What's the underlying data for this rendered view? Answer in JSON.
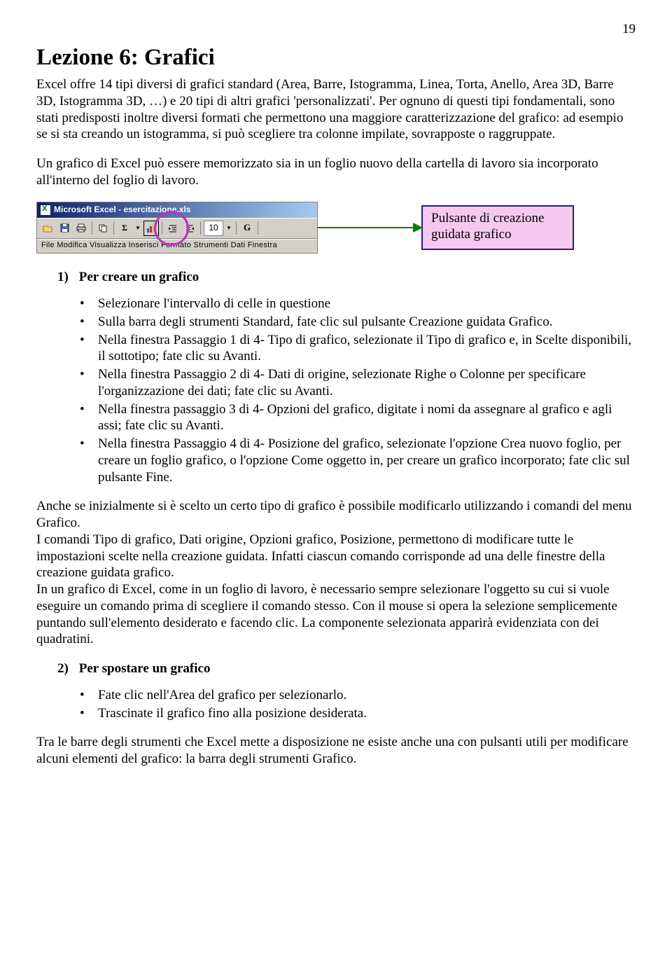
{
  "page_number": "19",
  "title": "Lezione 6: Grafici",
  "intro_p1": "Excel offre 14 tipi diversi di grafici standard (Area, Barre, Istogramma, Linea, Torta, Anello, Area 3D, Barre 3D, Istogramma 3D, …) e 20 tipi di altri grafici 'personalizzati'. Per ognuno di questi tipi fondamentali, sono stati predisposti inoltre diversi formati che permettono una maggiore caratterizzazione del grafico: ad esempio se si sta creando un istogramma, si può scegliere tra colonne impilate, sovrapposte o raggruppate.",
  "intro_p2": "Un grafico di Excel può essere memorizzato sia in un foglio nuovo della cartella di lavoro sia incorporato all'interno del foglio di lavoro.",
  "toolbar": {
    "title": "Microsoft Excel - esercitazione.xls",
    "menu": "File  Modifica  Visualizza  Inserisci  Formato  Strumenti  Dati  Finestra",
    "fontsize": "10"
  },
  "callout": "Pulsante di creazione guidata grafico",
  "section1": {
    "num": "1)",
    "title": "Per creare un grafico",
    "items": [
      "Selezionare l'intervallo di celle in questione",
      "Sulla barra degli strumenti Standard, fate clic sul pulsante Creazione guidata Grafico.",
      "Nella finestra Passaggio 1 di 4- Tipo di grafico, selezionate il Tipo di grafico e, in Scelte disponibili, il sottotipo; fate clic su Avanti.",
      "Nella finestra Passaggio 2 di 4- Dati di origine, selezionate Righe o Colonne per specificare l'organizzazione dei dati; fate clic su Avanti.",
      "Nella finestra passaggio 3 di 4- Opzioni del grafico, digitate i nomi da assegnare al grafico e agli assi; fate clic su Avanti.",
      "Nella finestra Passaggio 4 di 4- Posizione del grafico, selezionate l'opzione Crea nuovo foglio, per creare un foglio grafico, o l'opzione Come oggetto in, per creare un grafico incorporato; fate clic  sul pulsante Fine."
    ]
  },
  "middle_p1": "Anche se inizialmente si è scelto un certo tipo di grafico è possibile modificarlo utilizzando i comandi del menu Grafico.",
  "middle_p2": "I comandi Tipo di grafico, Dati origine, Opzioni grafico, Posizione, permettono di modificare tutte le impostazioni scelte nella creazione guidata. Infatti ciascun comando corrisponde ad una delle finestre della creazione guidata grafico.",
  "middle_p3": "In un grafico di Excel, come in un foglio di lavoro, è necessario sempre selezionare l'oggetto su cui si vuole eseguire un comando prima di scegliere il comando stesso. Con il mouse si opera la selezione semplicemente puntando sull'elemento desiderato e facendo clic. La componente selezionata apparirà evidenziata con dei quadratini.",
  "section2": {
    "num": "2)",
    "title": "Per spostare un grafico",
    "items": [
      "Fate clic nell'Area del grafico per selezionarlo.",
      "Trascinate il grafico fino alla posizione desiderata."
    ]
  },
  "closing": "Tra le barre degli strumenti che Excel mette a disposizione ne esiste anche una con pulsanti utili per modificare alcuni elementi del grafico: la barra degli strumenti Grafico."
}
